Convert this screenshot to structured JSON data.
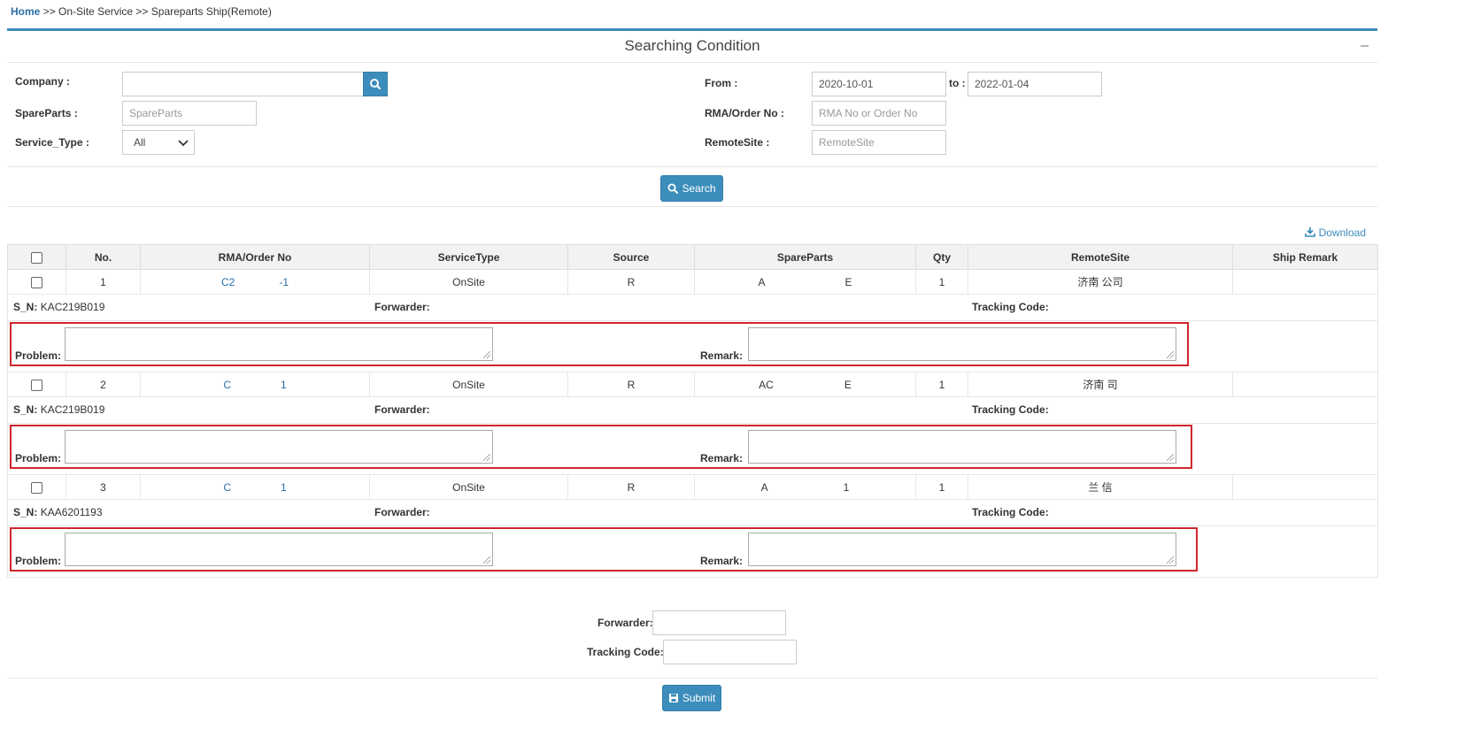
{
  "breadcrumb": {
    "home": "Home",
    "sep1": ">>",
    "section": "On-Site Service",
    "sep2": ">>",
    "page": "Spareparts Ship(Remote)"
  },
  "panel": {
    "title": "Searching Condition",
    "collapse_symbol": "–"
  },
  "form": {
    "company_label": "Company :",
    "company_value": "",
    "spareparts_label": "SpareParts :",
    "spareparts_placeholder": "SpareParts",
    "service_type_label": "Service_Type :",
    "service_type_value": "All",
    "from_label": "From :",
    "from_value": "2020-10-01",
    "to_label": "to :",
    "to_value": "2022-01-04",
    "rma_label": "RMA/Order No :",
    "rma_placeholder": "RMA No or Order No",
    "remote_site_label": "RemoteSite :",
    "remote_site_placeholder": "RemoteSite",
    "search_button": "Search"
  },
  "download_label": "Download",
  "table": {
    "headers": [
      "No.",
      "RMA/Order No",
      "ServiceType",
      "Source",
      "SpareParts",
      "Qty",
      "RemoteSite",
      "Ship Remark"
    ],
    "rows": [
      {
        "no": "1",
        "rma_a": "C2",
        "rma_b": "-1",
        "service_type": "OnSite",
        "source": "R",
        "part_a": "A",
        "part_b": "E",
        "qty": "1",
        "remote_site": "济南 公司",
        "ship_remark": "",
        "sn_label": "S_N:",
        "sn": "KAC219B019",
        "forwarder_label": "Forwarder:",
        "tracking_label": "Tracking Code:",
        "problem_label": "Problem:",
        "remark_label": "Remark:"
      },
      {
        "no": "2",
        "rma_a": "C",
        "rma_b": "1",
        "service_type": "OnSite",
        "source": "R",
        "part_a": "AC",
        "part_b": "E",
        "qty": "1",
        "remote_site": "济南 司",
        "ship_remark": "",
        "sn_label": "S_N:",
        "sn": "KAC219B019",
        "forwarder_label": "Forwarder:",
        "tracking_label": "Tracking Code:",
        "problem_label": "Problem:",
        "remark_label": "Remark:"
      },
      {
        "no": "3",
        "rma_a": "C",
        "rma_b": "1",
        "service_type": "OnSite",
        "source": "R",
        "part_a": "A",
        "part_b": "1",
        "qty": "1",
        "remote_site": "兰 信",
        "ship_remark": "",
        "sn_label": "S_N:",
        "sn": "KAA6201193",
        "forwarder_label": "Forwarder:",
        "tracking_label": "Tracking Code:",
        "problem_label": "Problem:",
        "remark_label": "Remark:"
      }
    ]
  },
  "footer": {
    "forwarder_label": "Forwarder:",
    "tracking_label": "Tracking Code:",
    "submit_button": "Submit"
  },
  "colors": {
    "accent": "#3c8dbc",
    "link": "#2a6ea8",
    "highlight_border": "#d0262e"
  }
}
